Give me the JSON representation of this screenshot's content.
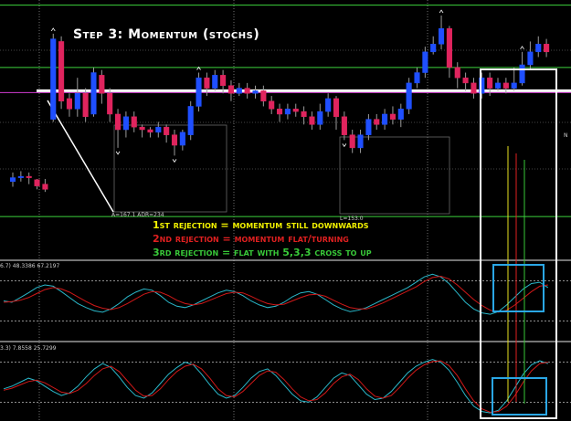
{
  "title": "Step 3: Momentum (stochs)",
  "colors": {
    "background": "#000000",
    "up_candle": "#1f4fff",
    "down_candle": "#e0245e",
    "green_line": "#3cd23c",
    "magenta_line": "#d23cd2",
    "white_line": "#ffffff",
    "stoch_main": "#2ab7c9",
    "stoch_signal": "#d01818",
    "annotation_yellow": "#f2f200",
    "annotation_red": "#e02020",
    "annotation_green": "#38c838",
    "box_cyan": "#2aa7e6"
  },
  "annotations": [
    {
      "text": "1st rejection = momentum still downwards",
      "color": "#f2f200"
    },
    {
      "text": "2nd rejection = momentum flat/turning",
      "color": "#e02020"
    },
    {
      "text": "3rd rejection = flat with 5,3,3 cross to up",
      "color": "#38c838"
    }
  ],
  "labels": {
    "range_label": "A=167.1  ADR=234",
    "low_label": "L=153.0",
    "stoch1_values": "6.7) 48.3386 67.2197",
    "stoch2_values": "3.3) 7.8558 25.7299",
    "edge_label": "N"
  },
  "chart_data": [
    {
      "type": "candlestick",
      "title": "Step 3: Momentum (stochs)",
      "y_range": [
        0,
        100
      ],
      "candles": [
        [
          30,
          31.5,
          33.5,
          28
        ],
        [
          31.5,
          32,
          34,
          30
        ],
        [
          32,
          31.7,
          33.5,
          29
        ],
        [
          30.7,
          28.3,
          31,
          27
        ],
        [
          29,
          27,
          31,
          26
        ],
        [
          54,
          85,
          87,
          53
        ],
        [
          84,
          61,
          86,
          58
        ],
        [
          62,
          58,
          64,
          55
        ],
        [
          58,
          64,
          70,
          55
        ],
        [
          64,
          55,
          66,
          53
        ],
        [
          56,
          72,
          74,
          55
        ],
        [
          71,
          64,
          73,
          60
        ],
        [
          64,
          56,
          66,
          53
        ],
        [
          56,
          50,
          58,
          43
        ],
        [
          50,
          55,
          57,
          47
        ],
        [
          55,
          51,
          57,
          49
        ],
        [
          51,
          50,
          52,
          47
        ],
        [
          50,
          49,
          51,
          47
        ],
        [
          49,
          51,
          53,
          47
        ],
        [
          51,
          48,
          52,
          45
        ],
        [
          48,
          44,
          50,
          40
        ],
        [
          44,
          49,
          50,
          42
        ],
        [
          48,
          59,
          61,
          46
        ],
        [
          59,
          70,
          72,
          57
        ],
        [
          70,
          66,
          72,
          63
        ],
        [
          66,
          71,
          73,
          65
        ],
        [
          71,
          67,
          73,
          64
        ],
        [
          67,
          64,
          69,
          61
        ],
        [
          64,
          66,
          68,
          63
        ],
        [
          66,
          64,
          68,
          62
        ],
        [
          64,
          65,
          67,
          62
        ],
        [
          65,
          61,
          67,
          59
        ],
        [
          61,
          58,
          63,
          56
        ],
        [
          58,
          56,
          60,
          53
        ],
        [
          56,
          58,
          60,
          54
        ],
        [
          58,
          57,
          60,
          55
        ],
        [
          57,
          55,
          59,
          52
        ],
        [
          55,
          52,
          57,
          50
        ],
        [
          52,
          57,
          60,
          50
        ],
        [
          57,
          62,
          64,
          55
        ],
        [
          62,
          55,
          63,
          50
        ],
        [
          55,
          48,
          57,
          46
        ],
        [
          48,
          43,
          50,
          41
        ],
        [
          43,
          48,
          50,
          41
        ],
        [
          48,
          54,
          56,
          46
        ],
        [
          54,
          52,
          56,
          50
        ],
        [
          52,
          56,
          58,
          50
        ],
        [
          56,
          54,
          59,
          52
        ],
        [
          54,
          58,
          60,
          51
        ],
        [
          58,
          68,
          70,
          56
        ],
        [
          68,
          72,
          74,
          66
        ],
        [
          72,
          80,
          82,
          70
        ],
        [
          80,
          83,
          86,
          79
        ],
        [
          83,
          89,
          94,
          81
        ],
        [
          89,
          74,
          90,
          70
        ],
        [
          74,
          70,
          76,
          66
        ],
        [
          70,
          68,
          72,
          65
        ],
        [
          68,
          64,
          70,
          62
        ],
        [
          64,
          70,
          72,
          62
        ],
        [
          70,
          66,
          72,
          63
        ],
        [
          66,
          68,
          70,
          65
        ],
        [
          68,
          66,
          70,
          64
        ],
        [
          66,
          68,
          74,
          65
        ],
        [
          68,
          75,
          80,
          67
        ],
        [
          75,
          80,
          84,
          73
        ],
        [
          80,
          83,
          86,
          78
        ],
        [
          83,
          80,
          85,
          78
        ]
      ],
      "horizontal_levels": [
        {
          "name": "green",
          "values": [
            98,
            74,
            16.5
          ]
        },
        {
          "name": "magenta",
          "values": [
            64.3
          ]
        },
        {
          "name": "white",
          "values": [
            65
          ]
        }
      ]
    },
    {
      "type": "line",
      "title": "",
      "y_range": [
        0,
        100
      ],
      "series": [
        {
          "values": [
            50,
            48,
            55,
            62,
            70,
            74,
            72,
            64,
            55,
            46,
            40,
            35,
            33,
            38,
            46,
            56,
            63,
            68,
            66,
            58,
            48,
            42,
            40,
            44,
            50,
            56,
            62,
            66,
            64,
            58,
            50,
            44,
            40,
            42,
            48,
            56,
            62,
            64,
            60,
            52,
            44,
            38,
            34,
            36,
            40,
            46,
            52,
            58,
            64,
            70,
            78,
            86,
            90,
            86,
            76,
            62,
            48,
            38,
            32,
            30,
            34,
            44,
            56,
            68,
            76,
            78,
            70
          ]
        },
        {
          "values": [
            48,
            49,
            51,
            55,
            61,
            67,
            70,
            68,
            63,
            56,
            49,
            43,
            39,
            37,
            40,
            46,
            53,
            60,
            64,
            63,
            58,
            51,
            46,
            44,
            46,
            51,
            56,
            61,
            63,
            62,
            57,
            51,
            46,
            44,
            45,
            50,
            55,
            59,
            60,
            57,
            51,
            45,
            40,
            38,
            38,
            42,
            47,
            53,
            59,
            65,
            71,
            79,
            85,
            87,
            83,
            74,
            63,
            52,
            43,
            36,
            33,
            36,
            44,
            54,
            64,
            72,
            74
          ]
        }
      ]
    },
    {
      "type": "line",
      "title": "",
      "y_range": [
        0,
        100
      ],
      "series": [
        {
          "values": [
            40,
            44,
            50,
            56,
            52,
            44,
            36,
            30,
            34,
            44,
            58,
            70,
            78,
            72,
            58,
            42,
            30,
            26,
            34,
            48,
            62,
            72,
            80,
            76,
            62,
            46,
            32,
            26,
            30,
            42,
            56,
            66,
            70,
            60,
            46,
            32,
            22,
            20,
            28,
            42,
            56,
            64,
            60,
            46,
            32,
            24,
            26,
            36,
            50,
            64,
            74,
            80,
            84,
            80,
            68,
            50,
            30,
            14,
            6,
            4,
            8,
            22,
            42,
            62,
            76,
            82,
            78
          ]
        },
        {
          "values": [
            38,
            41,
            46,
            51,
            53,
            49,
            42,
            35,
            33,
            38,
            48,
            60,
            70,
            74,
            66,
            52,
            38,
            29,
            30,
            40,
            54,
            66,
            74,
            77,
            70,
            56,
            40,
            30,
            28,
            36,
            48,
            60,
            67,
            65,
            54,
            40,
            28,
            22,
            24,
            34,
            48,
            58,
            62,
            54,
            40,
            29,
            26,
            30,
            42,
            56,
            68,
            76,
            81,
            82,
            75,
            60,
            40,
            22,
            10,
            5,
            6,
            14,
            30,
            50,
            67,
            78,
            80
          ]
        }
      ]
    }
  ]
}
